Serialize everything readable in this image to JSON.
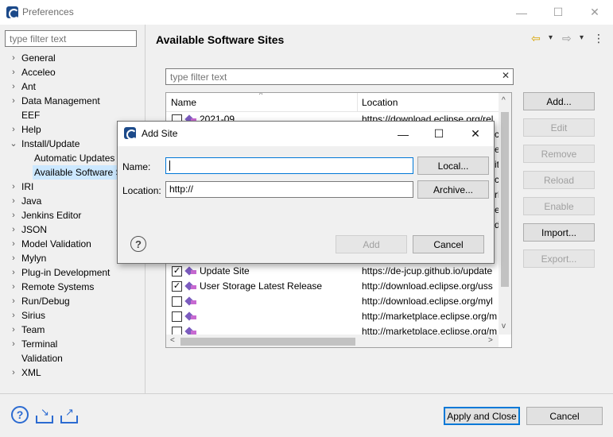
{
  "window": {
    "title": "Preferences",
    "minimize_glyph": "—",
    "maximize_glyph": "☐",
    "close_glyph": "✕"
  },
  "left": {
    "filter_placeholder": "type filter text",
    "tree": [
      {
        "label": "General",
        "expander": "›",
        "indent": 0
      },
      {
        "label": "Acceleo",
        "expander": "›",
        "indent": 0
      },
      {
        "label": "Ant",
        "expander": "›",
        "indent": 0
      },
      {
        "label": "Data Management",
        "expander": "›",
        "indent": 0
      },
      {
        "label": "EEF",
        "expander": "",
        "indent": 0
      },
      {
        "label": "Help",
        "expander": "›",
        "indent": 0
      },
      {
        "label": "Install/Update",
        "expander": "⌄",
        "indent": 0
      },
      {
        "label": "Automatic Updates",
        "expander": "",
        "indent": 1
      },
      {
        "label": "Available Software S",
        "expander": "",
        "indent": 1,
        "selected": true
      },
      {
        "label": "IRI",
        "expander": "›",
        "indent": 0
      },
      {
        "label": "Java",
        "expander": "›",
        "indent": 0
      },
      {
        "label": "Jenkins Editor",
        "expander": "›",
        "indent": 0
      },
      {
        "label": "JSON",
        "expander": "›",
        "indent": 0
      },
      {
        "label": "Model Validation",
        "expander": "›",
        "indent": 0
      },
      {
        "label": "Mylyn",
        "expander": "›",
        "indent": 0
      },
      {
        "label": "Plug-in Development",
        "expander": "›",
        "indent": 0
      },
      {
        "label": "Remote Systems",
        "expander": "›",
        "indent": 0
      },
      {
        "label": "Run/Debug",
        "expander": "›",
        "indent": 0
      },
      {
        "label": "Sirius",
        "expander": "›",
        "indent": 0
      },
      {
        "label": "Team",
        "expander": "›",
        "indent": 0
      },
      {
        "label": "Terminal",
        "expander": "›",
        "indent": 0
      },
      {
        "label": "Validation",
        "expander": "",
        "indent": 0
      },
      {
        "label": "XML",
        "expander": "›",
        "indent": 0
      }
    ]
  },
  "page": {
    "title": "Available Software Sites",
    "nav_back": "⇦",
    "nav_dropdown": "▾",
    "nav_forward": "⇨",
    "nav_menu": "⋮",
    "filter_placeholder": "type filter text",
    "filter_clear": "✕",
    "table": {
      "col_name": "Name",
      "col_location": "Location",
      "sort_glyph": "^",
      "rows": [
        {
          "checked": false,
          "name": "2021-09",
          "location": "https://download.eclipse.org/rel"
        },
        {
          "checked": true,
          "name": "Update Site",
          "location": "https://de-jcup.github.io/update"
        },
        {
          "checked": true,
          "name": "User Storage Latest Release",
          "location": "http://download.eclipse.org/uss"
        },
        {
          "checked": false,
          "name": "",
          "location": "http://download.eclipse.org/myl"
        },
        {
          "checked": false,
          "name": "",
          "location": "http://marketplace.eclipse.org/m"
        },
        {
          "checked": false,
          "name": "",
          "location": "http://marketplace.eclipse.org/m"
        }
      ],
      "partial_location_fragments": [
        "cl",
        "el",
        "it",
        "ch",
        "rk",
        "ey",
        "d"
      ],
      "scroll_left": "<",
      "scroll_right": ">",
      "scroll_up": "^",
      "scroll_down": "v"
    },
    "buttons": {
      "add": "Add...",
      "edit": "Edit",
      "remove": "Remove",
      "reload": "Reload",
      "enable": "Enable",
      "import": "Import...",
      "export": "Export..."
    }
  },
  "footer": {
    "apply_close": "Apply and Close",
    "cancel": "Cancel",
    "help_glyph": "?",
    "import_glyph": "↘",
    "export_glyph": "↗"
  },
  "dialog": {
    "title": "Add Site",
    "name_label": "Name:",
    "name_value": "",
    "location_label": "Location:",
    "location_value": "http://",
    "local_button": "Local...",
    "archive_button": "Archive...",
    "add_button": "Add",
    "cancel_button": "Cancel",
    "help_glyph": "?",
    "minimize_glyph": "—",
    "maximize_glyph": "☐",
    "close_glyph": "✕"
  }
}
